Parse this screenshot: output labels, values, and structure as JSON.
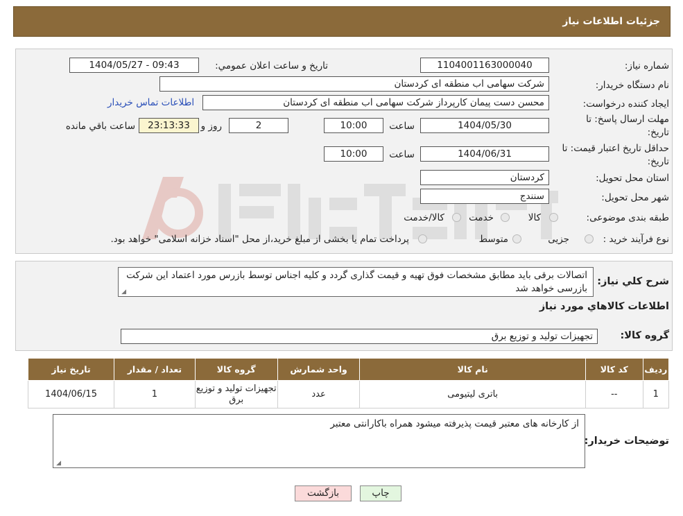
{
  "header": {
    "title": "جزئیات اطلاعات نیاز"
  },
  "fields": {
    "need_number_label": "شماره نیاز:",
    "need_number": "1104001163000040",
    "announce_label": "تاريخ و ساعت اعلان عمومي:",
    "announce_value": "1404/05/27 - 09:43",
    "buyer_org_label": "نام دستگاه خریدار:",
    "buyer_org": "شرکت سهامی اب منطقه ای کردستان",
    "creator_label": "ایجاد کننده درخواست:",
    "creator": "محسن دست پیمان کارپرداز شرکت سهامی اب منطقه ای کردستان",
    "contact_link": "اطلاعات تماس خریدار",
    "deadline_label_1": "مهلت ارسال پاسخ: تا",
    "deadline_label_2": "تاریخ:",
    "deadline_date": "1404/05/30",
    "time_label": "ساعت",
    "deadline_time": "10:00",
    "days_value": "2",
    "days_and_label": "روز و",
    "remaining_time": "23:13:33",
    "remaining_label": "ساعت باقي مانده",
    "validity_label_1": "حداقل تاریخ اعتبار قیمت: تا",
    "validity_label_2": "تاریخ:",
    "validity_date": "1404/06/31",
    "validity_time": "10:00",
    "province_label": "استان محل تحویل:",
    "province": "کردستان",
    "city_label": "شهر محل تحویل:",
    "city": "سنندج",
    "category_label": "طبقه بندی موضوعی:",
    "category_options": [
      "کالا",
      "خدمت",
      "کالا/خدمت"
    ],
    "process_label": "نوع فرآیند خرید :",
    "process_options": [
      "جزیی",
      "متوسط"
    ],
    "process_note": "پرداخت تمام یا بخشی از مبلغ خرید،از محل \"اسناد خزانه اسلامی\" خواهد بود."
  },
  "description": {
    "label": "شرح کلي نياز:",
    "text": "اتصالات برقی باید مطابق مشخصات فوق تهیه و قیمت گذاری  گردد و کلیه اجناس توسط بازرس مورد اعتماد این شرکت بازرسی خواهد شد"
  },
  "goods": {
    "section_title": "اطلاعات کالاهاي مورد نياز",
    "group_label": "گروه کالا:",
    "group_value": "تجهیزات تولید و توزیع برق",
    "columns": [
      "رديف",
      "کد کالا",
      "نام کالا",
      "واحد شمارش",
      "گروه کالا",
      "تعداد / مقدار",
      "تاریخ نیاز"
    ],
    "rows": [
      {
        "row": "1",
        "code": "--",
        "name": "باتری لیتیومی",
        "unit": "عدد",
        "group": "تجهیزات تولید و توزیع برق",
        "qty": "1",
        "date": "1404/06/15"
      }
    ]
  },
  "buyer_notes": {
    "label": "توضیحات خریدار:",
    "text": "از کارخانه های معتبر قیمت پذیرفته میشود همراه باکارانتی معتبر"
  },
  "buttons": {
    "print": "چاپ",
    "back": "بازگشت"
  },
  "colors": {
    "header_brown": "#8b6a3a",
    "panel_gray": "#f2f2f2",
    "link_blue": "#2a4fb8",
    "remaining_yellow": "#fbf5cf"
  }
}
